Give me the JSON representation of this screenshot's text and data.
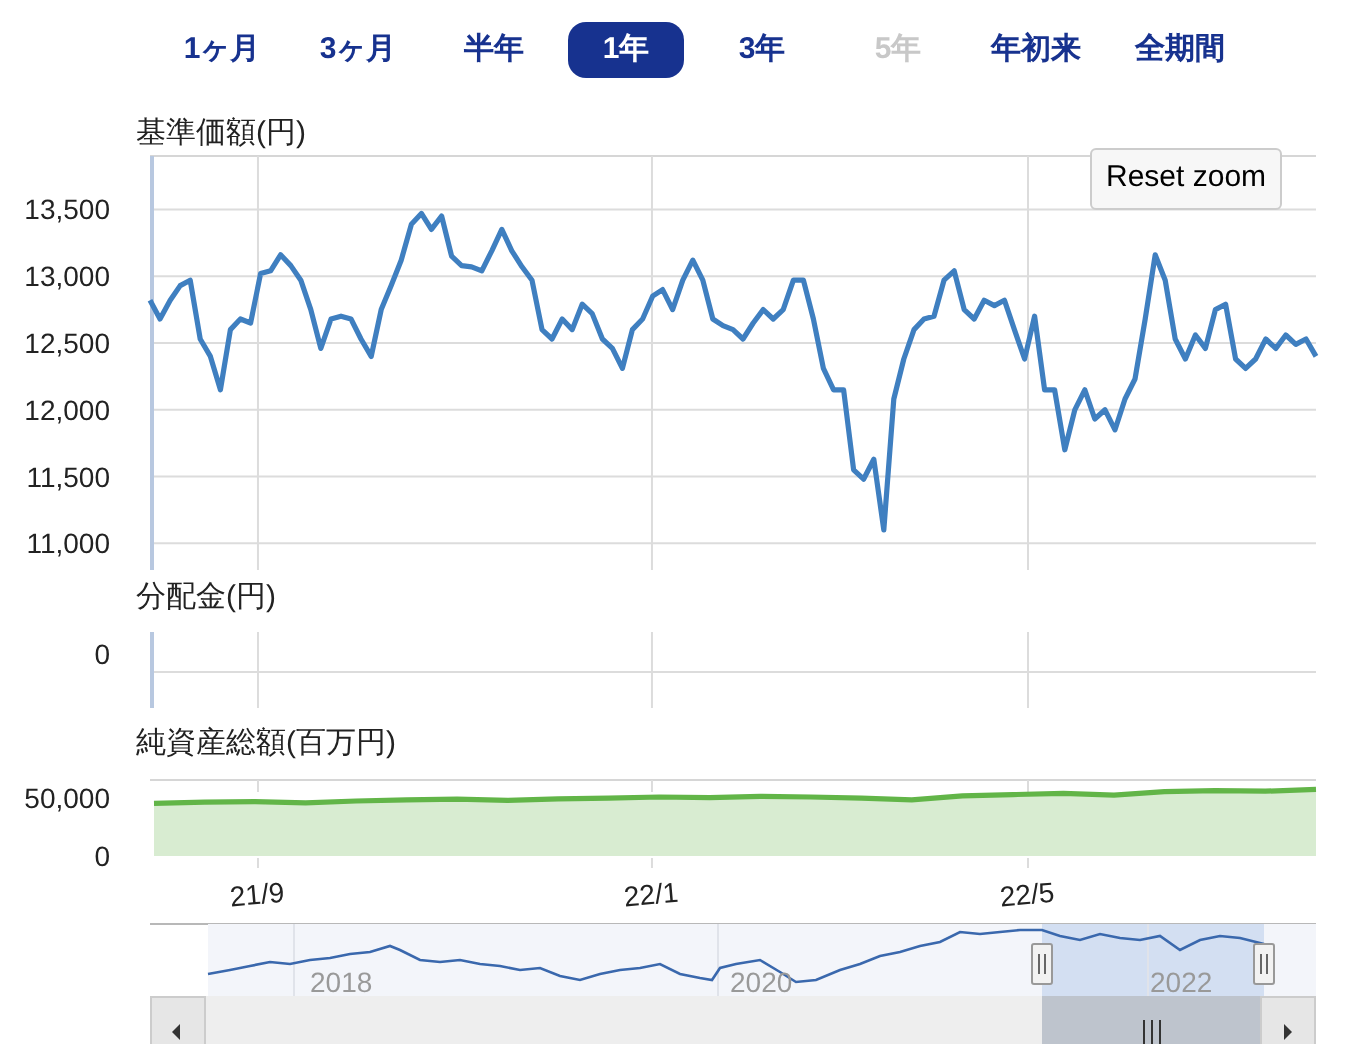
{
  "tabs": [
    {
      "label": "1ヶ月",
      "selected": false,
      "disabled": false
    },
    {
      "label": "3ヶ月",
      "selected": false,
      "disabled": false
    },
    {
      "label": "半年",
      "selected": false,
      "disabled": false
    },
    {
      "label": "1年",
      "selected": true,
      "disabled": false
    },
    {
      "label": "3年",
      "selected": false,
      "disabled": false
    },
    {
      "label": "5年",
      "selected": false,
      "disabled": true
    },
    {
      "label": "年初来",
      "selected": false,
      "disabled": false
    },
    {
      "label": "全期間",
      "selected": false,
      "disabled": false
    }
  ],
  "reset_button": "Reset zoom",
  "price_chart": {
    "title": "基準価額(円)",
    "chart_data": {
      "type": "line",
      "grid": true,
      "ylim": [
        10800,
        13900
      ],
      "yticks": [
        {
          "value": 11000,
          "label": "11,000"
        },
        {
          "value": 11500,
          "label": "11,500"
        },
        {
          "value": 12000,
          "label": "12,000"
        },
        {
          "value": 12500,
          "label": "12,500"
        },
        {
          "value": 13000,
          "label": "13,000"
        },
        {
          "value": 13500,
          "label": "13,500"
        }
      ],
      "series": [
        {
          "color": "#3f7fc0",
          "values": [
            12820,
            12680,
            12820,
            12930,
            12970,
            12530,
            12400,
            12150,
            12600,
            12680,
            12650,
            13020,
            13040,
            13160,
            13080,
            12970,
            12750,
            12460,
            12680,
            12700,
            12680,
            12530,
            12400,
            12750,
            12930,
            13120,
            13390,
            13470,
            13350,
            13450,
            13150,
            13080,
            13070,
            13040,
            13190,
            13350,
            13190,
            13070,
            12970,
            12600,
            12530,
            12680,
            12600,
            12790,
            12720,
            12530,
            12460,
            12310,
            12600,
            12680,
            12850,
            12900,
            12750,
            12970,
            13120,
            12970,
            12680,
            12630,
            12600,
            12530,
            12650,
            12750,
            12680,
            12750,
            12970,
            12970,
            12680,
            12310,
            12150,
            12150,
            11550,
            11480,
            11630,
            11100,
            12080,
            12380,
            12600,
            12680,
            12700,
            12970,
            13040,
            12750,
            12680,
            12820,
            12780,
            12820,
            12600,
            12380,
            12700,
            12150,
            12150,
            11700,
            12000,
            12150,
            11930,
            12000,
            11850,
            12080,
            12230,
            12680,
            13160,
            12970,
            12530,
            12380,
            12560,
            12460,
            12750,
            12790,
            12380,
            12310,
            12380,
            12530,
            12460,
            12560,
            12490,
            12530,
            12400
          ]
        }
      ]
    }
  },
  "distribution_chart": {
    "title": "分配金(円)",
    "ytick": "0"
  },
  "net_assets_chart": {
    "title": "純資産総額(百万円)",
    "chart_data": {
      "type": "area",
      "ylim": [
        0,
        65000
      ],
      "yticks": [
        {
          "value": 0,
          "label": "0"
        },
        {
          "value": 50000,
          "label": "50,000"
        }
      ],
      "series": [
        {
          "color": "#62b548",
          "values": [
            45000,
            46000,
            46500,
            45500,
            47000,
            48000,
            48500,
            47500,
            49000,
            49500,
            50500,
            50000,
            51000,
            50500,
            49500,
            48000,
            51500,
            52500,
            53500,
            52000,
            55000,
            56000,
            55500,
            57000
          ]
        }
      ]
    }
  },
  "x_axis_labels": [
    "21/9",
    "22/1",
    "22/5"
  ],
  "navigator": {
    "year_labels": [
      "2018",
      "2020",
      "2022"
    ]
  }
}
